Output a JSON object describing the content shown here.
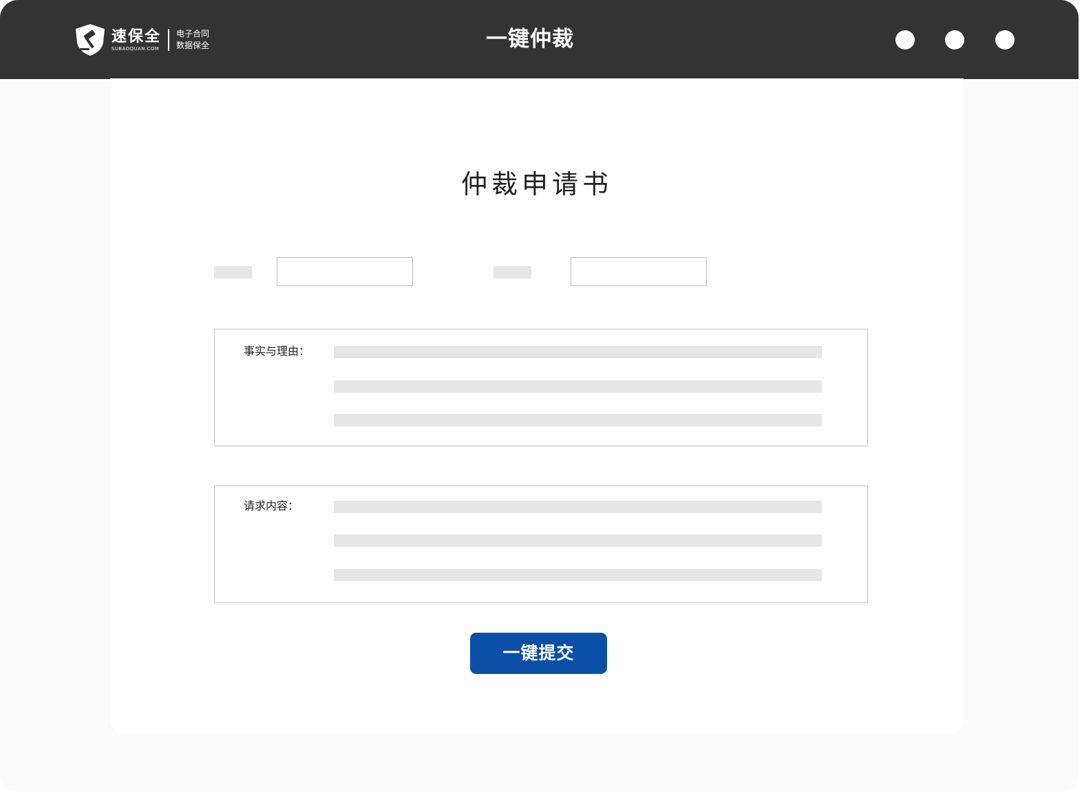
{
  "header": {
    "logo": {
      "brand_cn": "速保全",
      "brand_en": "SUBAOQUAN.COM",
      "tagline_1": "电子合同",
      "tagline_2": "数据保全"
    },
    "title": "一键仲裁",
    "window_controls": [
      "dot",
      "dot",
      "dot"
    ]
  },
  "form": {
    "title": "仲裁申请书",
    "field_1": {
      "label": "",
      "value": ""
    },
    "field_2": {
      "label": "",
      "value": ""
    },
    "facts_section": {
      "label": "事实与理由：",
      "lines": [
        "",
        "",
        ""
      ]
    },
    "request_section": {
      "label": "请求内容：",
      "lines": [
        "",
        "",
        ""
      ]
    },
    "submit_label": "一键提交"
  },
  "colors": {
    "titlebar": "#333333",
    "accent": "#0a4ea6",
    "placeholder": "#e6e6e6"
  }
}
